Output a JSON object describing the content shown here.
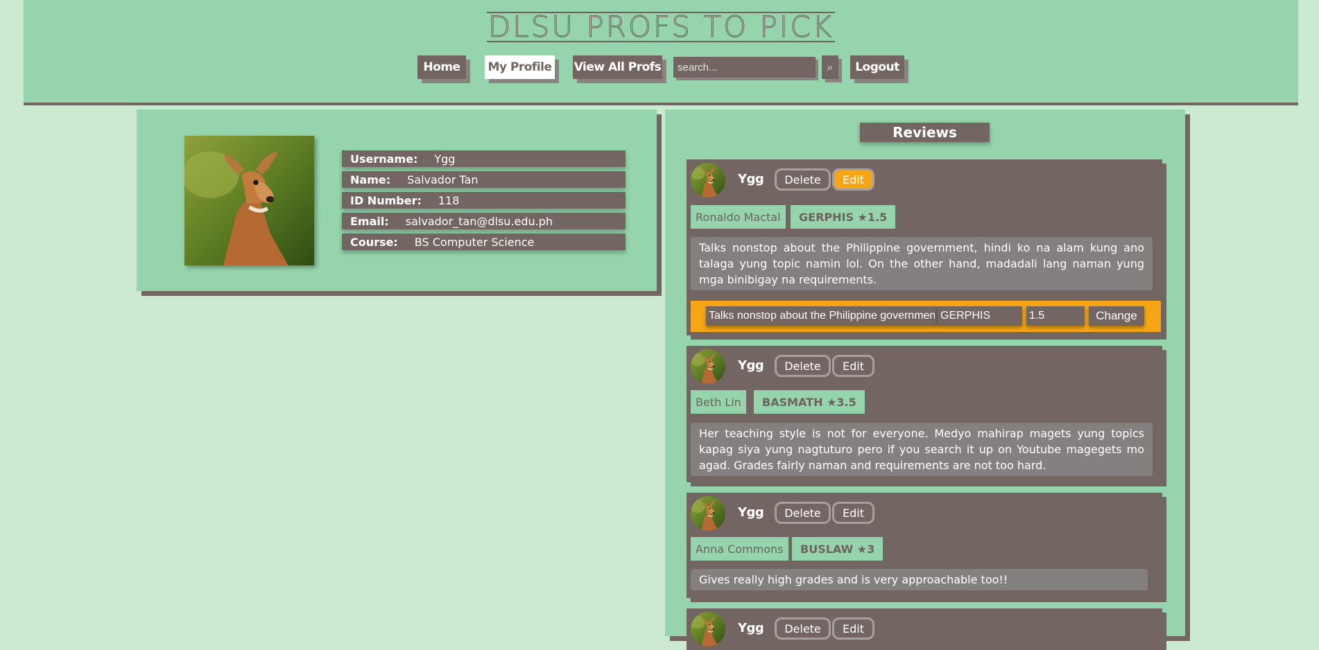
{
  "header": {
    "title": "DLSU PROFS TO PICK",
    "nav": {
      "home": "Home",
      "my_profile": "My Profile",
      "view_all_profs": "View All Profs",
      "logout": "Logout"
    },
    "search": {
      "placeholder": "search...",
      "value": ""
    },
    "search_button_icon": "search-icon"
  },
  "profile": {
    "labels": {
      "username": "Username:",
      "name": "Name:",
      "id_number": "ID Number:",
      "email": "Email:",
      "course": "Course:"
    },
    "values": {
      "username": "Ygg",
      "name": "Salvador Tan",
      "id_number": "118",
      "email": "salvador_tan@dlsu.edu.ph",
      "course": "BS Computer Science"
    }
  },
  "reviews": {
    "title": "Reviews",
    "delete_label": "Delete",
    "edit_label": "Edit",
    "change_label": "Change",
    "items": [
      {
        "user": "Ygg",
        "prof": "Ronaldo Mactal",
        "course_rating": "GERPHIS ★1.5",
        "text": "Talks nonstop about the Philippine government, hindi ko na alam kung ano talaga yung topic namin lol. On the other hand, madadali lang naman yung mga binibigay na requirements.",
        "edit_form": {
          "text_value": "Talks nonstop about the Philippine government, hindi ko na alam kung ano talaga yung topic namin lol. On the other hand, madadali lang naman yung mga binibigay na requirements.",
          "course_value": "GERPHIS",
          "rating_value": "1.5"
        }
      },
      {
        "user": "Ygg",
        "prof": "Beth Lin",
        "course_rating": "BASMATH ★3.5",
        "text": "Her teaching style is not for everyone. Medyo mahirap magets yung topics kapag siya yung nagtuturo pero if you search it up on Youtube magegets mo agad. Grades fairly naman and requirements are not too hard."
      },
      {
        "user": "Ygg",
        "prof": "Anna Commons",
        "course_rating": "BUSLAW ★3",
        "text": "Gives really high grades and is very approachable too!!"
      },
      {
        "user": "Ygg"
      }
    ]
  },
  "colors": {
    "page_bg": "#cbead1",
    "mint": "#95d4ac",
    "taupe": "#736662",
    "accent_orange": "#f6a615",
    "text_box_gray": "#858080"
  }
}
